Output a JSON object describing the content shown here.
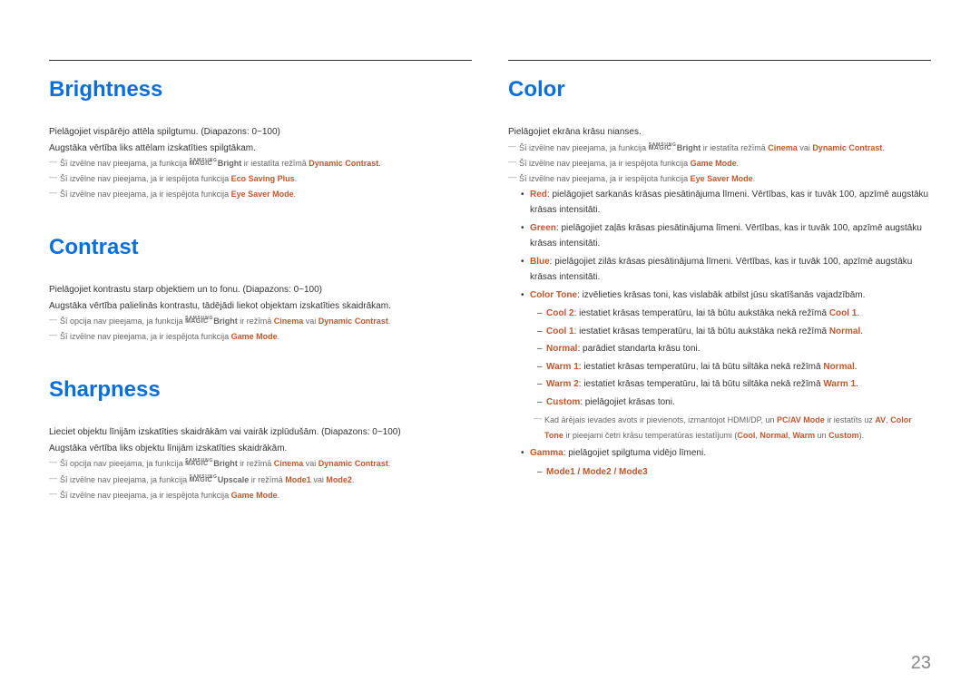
{
  "pagenum": "23",
  "left": {
    "brightness": {
      "title": "Brightness",
      "p1": "Pielāgojiet vispārējo attēla spilgtumu. (Diapazons: 0~100)",
      "p2": "Augstāka vērtība liks attēlam izskatīties spilgtākam.",
      "n1a": "Šī izvēlne nav pieejama, ja funkcija ",
      "n1b": " ir iestatīta režīmā ",
      "n1dc": "Dynamic Contrast",
      "n2a": "Šī izvēlne nav pieejama, ja ir iespējota funkcija ",
      "n2b": "Eco Saving Plus",
      "n3a": "Šī izvēlne nav pieejama, ja ir iespējota funkcija ",
      "n3b": "Eye Saver Mode"
    },
    "contrast": {
      "title": "Contrast",
      "p1": "Pielāgojiet kontrastu starp objektiem un to fonu. (Diapazons: 0~100)",
      "p2": "Augstāka vērtība palielinās kontrastu, tādējādi liekot objektam izskatīties skaidrākam.",
      "n1a": "Šī opcija nav pieejama, ja funkcija ",
      "n1b": " ir režīmā ",
      "n1c": "Cinema",
      "n1d": " vai ",
      "n1e": "Dynamic Contrast",
      "n2a": "Šī izvēlne nav pieejama, ja ir iespējota funkcija ",
      "n2b": "Game Mode"
    },
    "sharpness": {
      "title": "Sharpness",
      "p1": "Lieciet objektu līnijām izskatīties skaidrākām vai vairāk izplūdušām. (Diapazons: 0~100)",
      "p2": "Augstāka vērtība liks objektu līnijām izskatīties skaidrākām.",
      "n1a": "Šī opcija nav pieejama, ja funkcija ",
      "n1b": " ir režīmā ",
      "n1c": "Cinema",
      "n1d": " vai ",
      "n1e": "Dynamic Contrast",
      "n2a": "Šī izvēlne nav pieejama, ja funkcija ",
      "n2b": " ir režīmā ",
      "n2c": "Mode1",
      "n2d": " vai ",
      "n2e": "Mode2",
      "n3a": "Šī izvēlne nav pieejama, ja ir iespējota funkcija ",
      "n3b": "Game Mode"
    }
  },
  "right": {
    "color": {
      "title": "Color",
      "p1": "Pielāgojiet ekrāna krāsu nianses.",
      "n1a": "Šī izvēlne nav pieejama, ja funkcija ",
      "n1b": " ir iestatīta režīmā ",
      "n1c": "Cinema",
      "n1d": " vai ",
      "n1e": "Dynamic Contrast",
      "n2a": "Šī izvēlne nav pieejama, ja ir iespējota funkcija ",
      "n2b": "Game Mode",
      "n3a": "Šī izvēlne nav pieejama, ja ir iespējota funkcija ",
      "n3b": "Eye Saver Mode",
      "red_l": "Red",
      "red_t": ": pielāgojiet sarkanās krāsas piesātinājuma līmeni. Vērtības, kas ir tuvāk 100, apzīmē augstāku krāsas intensitāti.",
      "green_l": "Green",
      "green_t": ": pielāgojiet zaļās krāsas piesātinājuma līmeni. Vērtības, kas ir tuvāk 100, apzīmē augstāku krāsas intensitāti.",
      "blue_l": "Blue",
      "blue_t": ": pielāgojiet zilās krāsas piesātinājuma līmeni. Vērtības, kas ir tuvāk 100, apzīmē augstāku krāsas intensitāti.",
      "ct_l": "Color Tone",
      "ct_t": ": izvēlieties krāsas toni, kas vislabāk atbilst jūsu skatīšanās vajadzībām.",
      "cool2_l": "Cool 2",
      "cool2_t": ": iestatiet krāsas temperatūru, lai tā būtu aukstāka nekā režīmā ",
      "cool2_r": "Cool 1",
      "cool1_l": "Cool 1",
      "cool1_t": ": iestatiet krāsas temperatūru, lai tā būtu aukstāka nekā režīmā ",
      "cool1_r": "Normal",
      "normal_l": "Normal",
      "normal_t": ": parādiet standarta krāsu toni.",
      "warm1_l": "Warm 1",
      "warm1_t": ": iestatiet krāsas temperatūru, lai tā būtu siltāka nekā režīmā ",
      "warm1_r": "Normal",
      "warm2_l": "Warm 2",
      "warm2_t": ": iestatiet krāsas temperatūru, lai tā būtu siltāka nekā režīmā ",
      "warm2_r": "Warm 1",
      "custom_l": "Custom",
      "custom_t": ": pielāgojiet krāsas toni.",
      "note4a": "Kad ārējais ievades avots ir pievienots, izmantojot HDMI/DP, un ",
      "note4b": "PC/AV Mode",
      "note4c": " ir iestatīts uz ",
      "note4d": "AV",
      "note4e": ", ",
      "note4f": "Color Tone",
      "note4g": " ir pieejami četri krāsu temperatūras iestatījumi (",
      "note4h": "Cool",
      "note4i": ", ",
      "note4j": "Normal",
      "note4k": ", ",
      "note4l": "Warm",
      "note4m": " un ",
      "note4n": "Custom",
      "note4o": ").",
      "gamma_l": "Gamma",
      "gamma_t": ": pielāgojiet spilgtuma vidējo līmeni.",
      "modes": "Mode1 / Mode2 / Mode3"
    }
  },
  "magic_bright": "Bright",
  "magic_upscale": "Upscale",
  "samsung": "SAMSUNG",
  "magic": "MAGIC"
}
